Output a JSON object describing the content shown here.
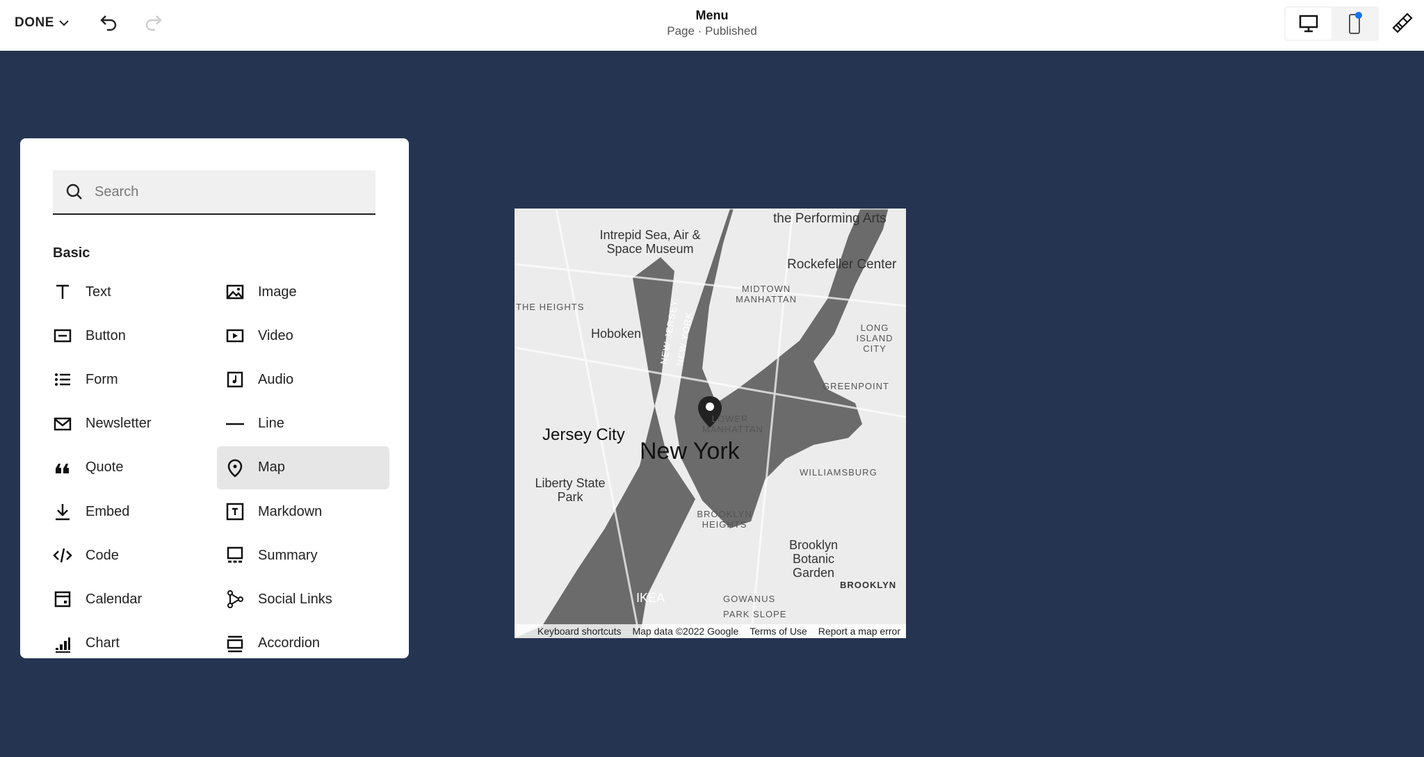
{
  "header": {
    "done_label": "DONE",
    "title": "Menu",
    "subtitle": "Page · Published"
  },
  "panel": {
    "search_placeholder": "Search",
    "section": "Basic",
    "items": [
      {
        "label": "Text",
        "icon": "text-icon"
      },
      {
        "label": "Image",
        "icon": "image-icon"
      },
      {
        "label": "Button",
        "icon": "button-icon"
      },
      {
        "label": "Video",
        "icon": "video-icon"
      },
      {
        "label": "Form",
        "icon": "form-icon"
      },
      {
        "label": "Audio",
        "icon": "audio-icon"
      },
      {
        "label": "Newsletter",
        "icon": "newsletter-icon"
      },
      {
        "label": "Line",
        "icon": "line-icon"
      },
      {
        "label": "Quote",
        "icon": "quote-icon"
      },
      {
        "label": "Map",
        "icon": "map-pin-icon",
        "selected": true
      },
      {
        "label": "Embed",
        "icon": "embed-icon"
      },
      {
        "label": "Markdown",
        "icon": "markdown-icon"
      },
      {
        "label": "Code",
        "icon": "code-icon"
      },
      {
        "label": "Summary",
        "icon": "summary-icon"
      },
      {
        "label": "Calendar",
        "icon": "calendar-icon"
      },
      {
        "label": "Social Links",
        "icon": "social-links-icon"
      },
      {
        "label": "Chart",
        "icon": "chart-icon"
      },
      {
        "label": "Accordion",
        "icon": "accordion-icon"
      }
    ]
  },
  "map": {
    "labels": [
      "New York",
      "Jersey City",
      "Hoboken",
      "Intrepid Sea, Air & Space Museum",
      "Rockefeller Center",
      "the Performing Arts",
      "MIDTOWN MANHATTAN",
      "LONG ISLAND CITY",
      "GREENPOINT",
      "WILLIAMSBURG",
      "LOWER MANHATTAN",
      "Liberty State Park",
      "BROOKLYN HEIGHTS",
      "Brooklyn Botanic Garden",
      "BROOKLYN",
      "GOWANUS",
      "PARK SLOPE",
      "IKEA",
      "THE HEIGHTS",
      "NEW JERSEY",
      "NEW YORK"
    ],
    "footer": [
      "Keyboard shortcuts",
      "Map data ©2022 Google",
      "Terms of Use",
      "Report a map error"
    ]
  },
  "colors": {
    "background": "#253551",
    "accent": "#1a73e8"
  }
}
